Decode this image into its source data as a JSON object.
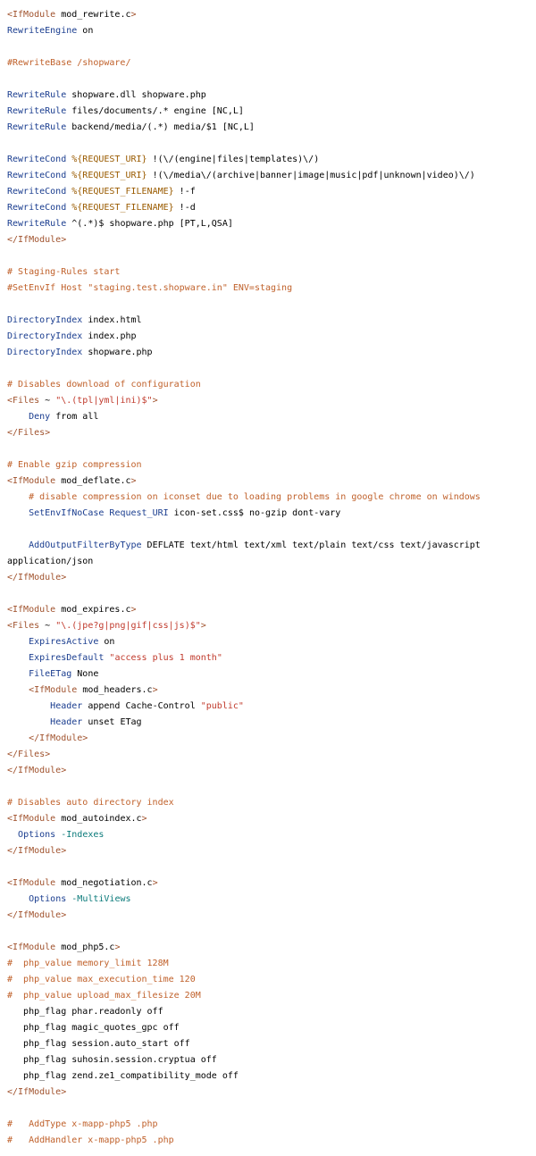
{
  "palette": {
    "tag": "#a0522d",
    "directive": "#1a3d8f",
    "string": "#c0392b",
    "variable": "#9a5b00",
    "comment": "#c0612b",
    "option": "#0a7a7a",
    "plain": "#000000",
    "background": "#ffffff"
  },
  "lines": [
    [
      [
        "tag",
        "<IfModule "
      ],
      [
        "pl",
        "mod_rewrite.c"
      ],
      [
        "tag",
        ">"
      ]
    ],
    [
      [
        "dir",
        "RewriteEngine"
      ],
      [
        "pl",
        " on"
      ]
    ],
    [],
    [
      [
        "com",
        "#RewriteBase /shopware/"
      ]
    ],
    [],
    [
      [
        "dir",
        "RewriteRule"
      ],
      [
        "pl",
        " shopware.dll shopware.php"
      ]
    ],
    [
      [
        "dir",
        "RewriteRule"
      ],
      [
        "pl",
        " files/documents/.* engine [NC,L]"
      ]
    ],
    [
      [
        "dir",
        "RewriteRule"
      ],
      [
        "pl",
        " backend/media/(.*) media/$1 [NC,L]"
      ]
    ],
    [],
    [
      [
        "dir",
        "RewriteCond"
      ],
      [
        "pl",
        " "
      ],
      [
        "var",
        "%{REQUEST_URI}"
      ],
      [
        "pl",
        " !(\\/(engine|files|templates)\\/)"
      ]
    ],
    [
      [
        "dir",
        "RewriteCond"
      ],
      [
        "pl",
        " "
      ],
      [
        "var",
        "%{REQUEST_URI}"
      ],
      [
        "pl",
        " !(\\/media\\/(archive|banner|image|music|pdf|unknown|video)\\/)"
      ]
    ],
    [
      [
        "dir",
        "RewriteCond"
      ],
      [
        "pl",
        " "
      ],
      [
        "var",
        "%{REQUEST_FILENAME}"
      ],
      [
        "pl",
        " !-f"
      ]
    ],
    [
      [
        "dir",
        "RewriteCond"
      ],
      [
        "pl",
        " "
      ],
      [
        "var",
        "%{REQUEST_FILENAME}"
      ],
      [
        "pl",
        " !-d"
      ]
    ],
    [
      [
        "dir",
        "RewriteRule"
      ],
      [
        "pl",
        " ^(.*)$ shopware.php [PT,L,QSA]"
      ]
    ],
    [
      [
        "tag",
        "</IfModule>"
      ]
    ],
    [],
    [
      [
        "com",
        "# Staging-Rules start"
      ]
    ],
    [
      [
        "com",
        "#SetEnvIf Host \"staging.test.shopware.in\" ENV=staging"
      ]
    ],
    [],
    [
      [
        "dir",
        "DirectoryIndex"
      ],
      [
        "pl",
        " index.html"
      ]
    ],
    [
      [
        "dir",
        "DirectoryIndex"
      ],
      [
        "pl",
        " index.php"
      ]
    ],
    [
      [
        "dir",
        "DirectoryIndex"
      ],
      [
        "pl",
        " shopware.php"
      ]
    ],
    [],
    [
      [
        "com",
        "# Disables download of configuration"
      ]
    ],
    [
      [
        "tag",
        "<Files "
      ],
      [
        "pl",
        "~ "
      ],
      [
        "str",
        "\"\\.(tpl|yml|ini)$\""
      ],
      [
        "tag",
        ">"
      ]
    ],
    [
      [
        "pl",
        "    "
      ],
      [
        "dir",
        "Deny"
      ],
      [
        "pl",
        " from all"
      ]
    ],
    [
      [
        "tag",
        "</Files>"
      ]
    ],
    [],
    [
      [
        "com",
        "# Enable gzip compression"
      ]
    ],
    [
      [
        "tag",
        "<IfModule "
      ],
      [
        "pl",
        "mod_deflate.c"
      ],
      [
        "tag",
        ">"
      ]
    ],
    [
      [
        "pl",
        "    "
      ],
      [
        "com",
        "# disable compression on iconset due to loading problems in google chrome on windows"
      ]
    ],
    [
      [
        "pl",
        "    "
      ],
      [
        "dir",
        "SetEnvIfNoCase"
      ],
      [
        "pl",
        " "
      ],
      [
        "dir",
        "Request_URI"
      ],
      [
        "pl",
        " icon-set.css$ no-gzip dont-vary"
      ]
    ],
    [],
    [
      [
        "pl",
        "    "
      ],
      [
        "dir",
        "AddOutputFilterByType"
      ],
      [
        "pl",
        " DEFLATE text/html text/xml text/plain text/css text/javascript"
      ]
    ],
    [
      [
        "pl",
        "application/json"
      ]
    ],
    [
      [
        "tag",
        "</IfModule>"
      ]
    ],
    [],
    [
      [
        "tag",
        "<IfModule "
      ],
      [
        "pl",
        "mod_expires.c"
      ],
      [
        "tag",
        ">"
      ]
    ],
    [
      [
        "tag",
        "<Files "
      ],
      [
        "pl",
        "~ "
      ],
      [
        "str",
        "\"\\.(jpe?g|png|gif|css|js)$\""
      ],
      [
        "tag",
        ">"
      ]
    ],
    [
      [
        "pl",
        "    "
      ],
      [
        "dir",
        "ExpiresActive"
      ],
      [
        "pl",
        " on"
      ]
    ],
    [
      [
        "pl",
        "    "
      ],
      [
        "dir",
        "ExpiresDefault"
      ],
      [
        "pl",
        " "
      ],
      [
        "str",
        "\"access plus 1 month\""
      ]
    ],
    [
      [
        "pl",
        "    "
      ],
      [
        "dir",
        "FileETag"
      ],
      [
        "pl",
        " None"
      ]
    ],
    [
      [
        "pl",
        "    "
      ],
      [
        "tag",
        "<IfModule "
      ],
      [
        "pl",
        "mod_headers.c"
      ],
      [
        "tag",
        ">"
      ]
    ],
    [
      [
        "pl",
        "        "
      ],
      [
        "dir",
        "Header"
      ],
      [
        "pl",
        " append Cache-Control "
      ],
      [
        "str",
        "\"public\""
      ]
    ],
    [
      [
        "pl",
        "        "
      ],
      [
        "dir",
        "Header"
      ],
      [
        "pl",
        " unset ETag"
      ]
    ],
    [
      [
        "pl",
        "    "
      ],
      [
        "tag",
        "</IfModule>"
      ]
    ],
    [
      [
        "tag",
        "</Files>"
      ]
    ],
    [
      [
        "tag",
        "</IfModule>"
      ]
    ],
    [],
    [
      [
        "com",
        "# Disables auto directory index"
      ]
    ],
    [
      [
        "tag",
        "<IfModule "
      ],
      [
        "pl",
        "mod_autoindex.c"
      ],
      [
        "tag",
        ">"
      ]
    ],
    [
      [
        "pl",
        "  "
      ],
      [
        "dir",
        "Options"
      ],
      [
        "pl",
        " "
      ],
      [
        "opt",
        "-Indexes"
      ]
    ],
    [
      [
        "tag",
        "</IfModule>"
      ]
    ],
    [],
    [
      [
        "tag",
        "<IfModule "
      ],
      [
        "pl",
        "mod_negotiation.c"
      ],
      [
        "tag",
        ">"
      ]
    ],
    [
      [
        "pl",
        "    "
      ],
      [
        "dir",
        "Options"
      ],
      [
        "pl",
        " "
      ],
      [
        "opt",
        "-MultiViews"
      ]
    ],
    [
      [
        "tag",
        "</IfModule>"
      ]
    ],
    [],
    [
      [
        "tag",
        "<IfModule "
      ],
      [
        "pl",
        "mod_php5.c"
      ],
      [
        "tag",
        ">"
      ]
    ],
    [
      [
        "com",
        "#  php_value memory_limit 128M"
      ]
    ],
    [
      [
        "com",
        "#  php_value max_execution_time 120"
      ]
    ],
    [
      [
        "com",
        "#  php_value upload_max_filesize 20M"
      ]
    ],
    [
      [
        "pl",
        "   php_flag phar.readonly off"
      ]
    ],
    [
      [
        "pl",
        "   php_flag magic_quotes_gpc off"
      ]
    ],
    [
      [
        "pl",
        "   php_flag session.auto_start off"
      ]
    ],
    [
      [
        "pl",
        "   php_flag suhosin.session.cryptua off"
      ]
    ],
    [
      [
        "pl",
        "   php_flag zend.ze1_compatibility_mode off"
      ]
    ],
    [
      [
        "tag",
        "</IfModule>"
      ]
    ],
    [],
    [
      [
        "com",
        "#   AddType x-mapp-php5 .php"
      ]
    ],
    [
      [
        "com",
        "#   AddHandler x-mapp-php5 .php"
      ]
    ]
  ]
}
